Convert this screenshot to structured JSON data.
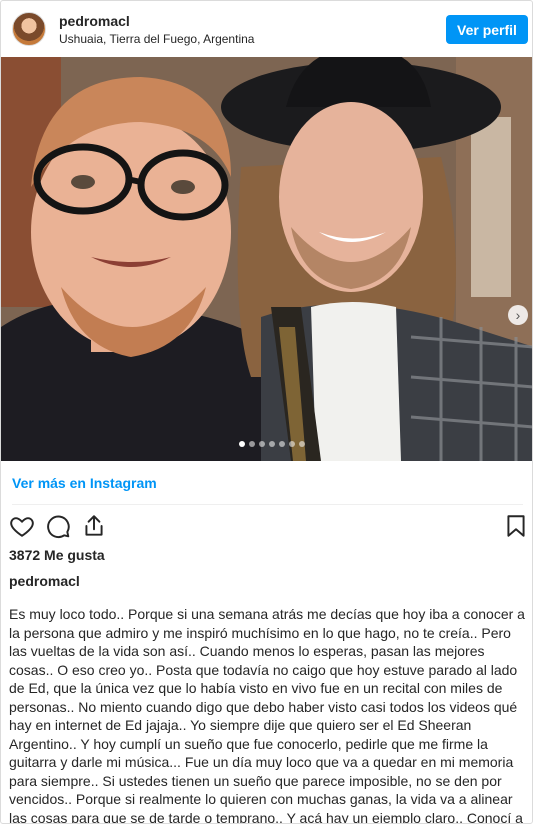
{
  "header": {
    "username": "pedromacl",
    "location": "Ushuaia, Tierra del Fuego, Argentina",
    "profile_button": "Ver perfil"
  },
  "photo": {
    "next_icon": "chevron-right-icon",
    "carousel_total": 7,
    "carousel_active": 1
  },
  "more_link": "Ver más en Instagram",
  "actions": {
    "like_icon": "heart-icon",
    "comment_icon": "comment-icon",
    "share_icon": "share-icon",
    "save_icon": "bookmark-icon"
  },
  "likes": "3872 Me gusta",
  "author": "pedromacl",
  "caption": "Es muy loco todo.. Porque si una semana atrás me decías que hoy iba a conocer a la persona que admiro y me inspiró muchísimo en lo que hago, no te creía.. Pero las vueltas de la vida son así.. Cuando menos lo esperas, pasan las mejores cosas.. O eso creo yo.. Posta que todavía no caigo que hoy estuve parado al lado de Ed, que la única vez que lo había visto en vivo fue en un recital con miles de personas.. No miento cuando digo que debo haber visto casi todos los videos qué hay en internet de Ed jajaja.. Yo siempre dije que quiero ser el Ed Sheeran Argentino.. Y hoy cumplí un sueño que fue conocerlo, pedirle que me firme la guitarra y darle mi música... Fue un día muy loco que va a quedar en mi memoria para siempre.. Si ustedes tienen un sueño que parece imposible, no se den por vencidos.. Porque si realmente lo quieren con muchas ganas, la vida va a alinear las cosas para que se de tarde o temprano.. Y acá hay un ejemplo claro.. Conocí a mi ídolo en Ushuaia.. Es",
  "colors": {
    "accent": "#0095f6",
    "text": "#262626",
    "border": "#dbdbdb"
  }
}
